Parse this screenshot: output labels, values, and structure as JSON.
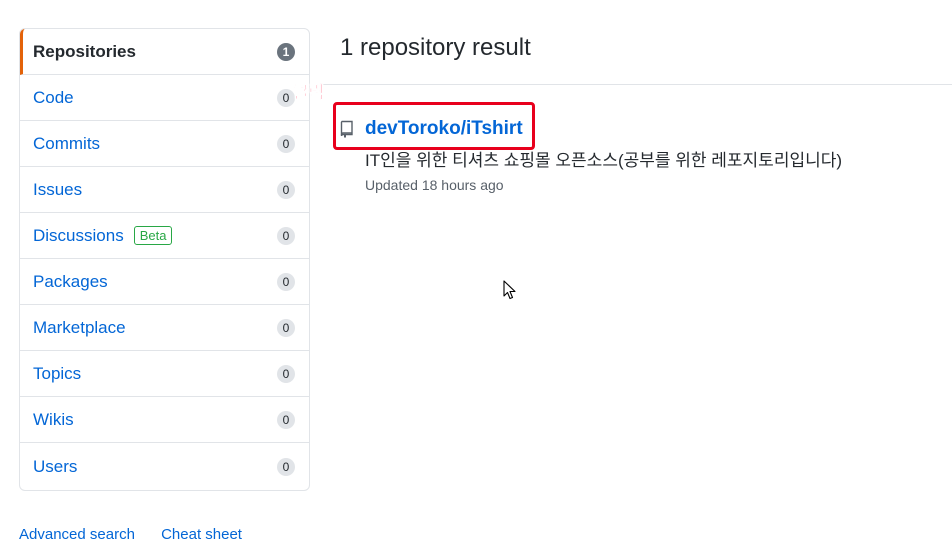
{
  "sidebar": {
    "items": [
      {
        "label": "Repositories",
        "count": "1",
        "selected": true
      },
      {
        "label": "Code",
        "count": "0"
      },
      {
        "label": "Commits",
        "count": "0"
      },
      {
        "label": "Issues",
        "count": "0"
      },
      {
        "label": "Discussions",
        "count": "0",
        "badge": "Beta"
      },
      {
        "label": "Packages",
        "count": "0"
      },
      {
        "label": "Marketplace",
        "count": "0"
      },
      {
        "label": "Topics",
        "count": "0"
      },
      {
        "label": "Wikis",
        "count": "0"
      },
      {
        "label": "Users",
        "count": "0"
      }
    ]
  },
  "footer": {
    "advanced_search": "Advanced search",
    "cheat_sheet": "Cheat sheet"
  },
  "main": {
    "heading": "1 repository result",
    "annotation_label": "클릭",
    "result": {
      "name": "devToroko/iTshirt",
      "description": "IT인을 위한 티셔츠 쇼핑몰 오픈소스(공부를 위한 레포지토리입니다)",
      "updated": "Updated 18 hours ago"
    }
  },
  "colors": {
    "accent_link": "#0366d6",
    "selected_border": "#e36209",
    "highlight_box": "#e8001c",
    "beta": "#28a745"
  }
}
